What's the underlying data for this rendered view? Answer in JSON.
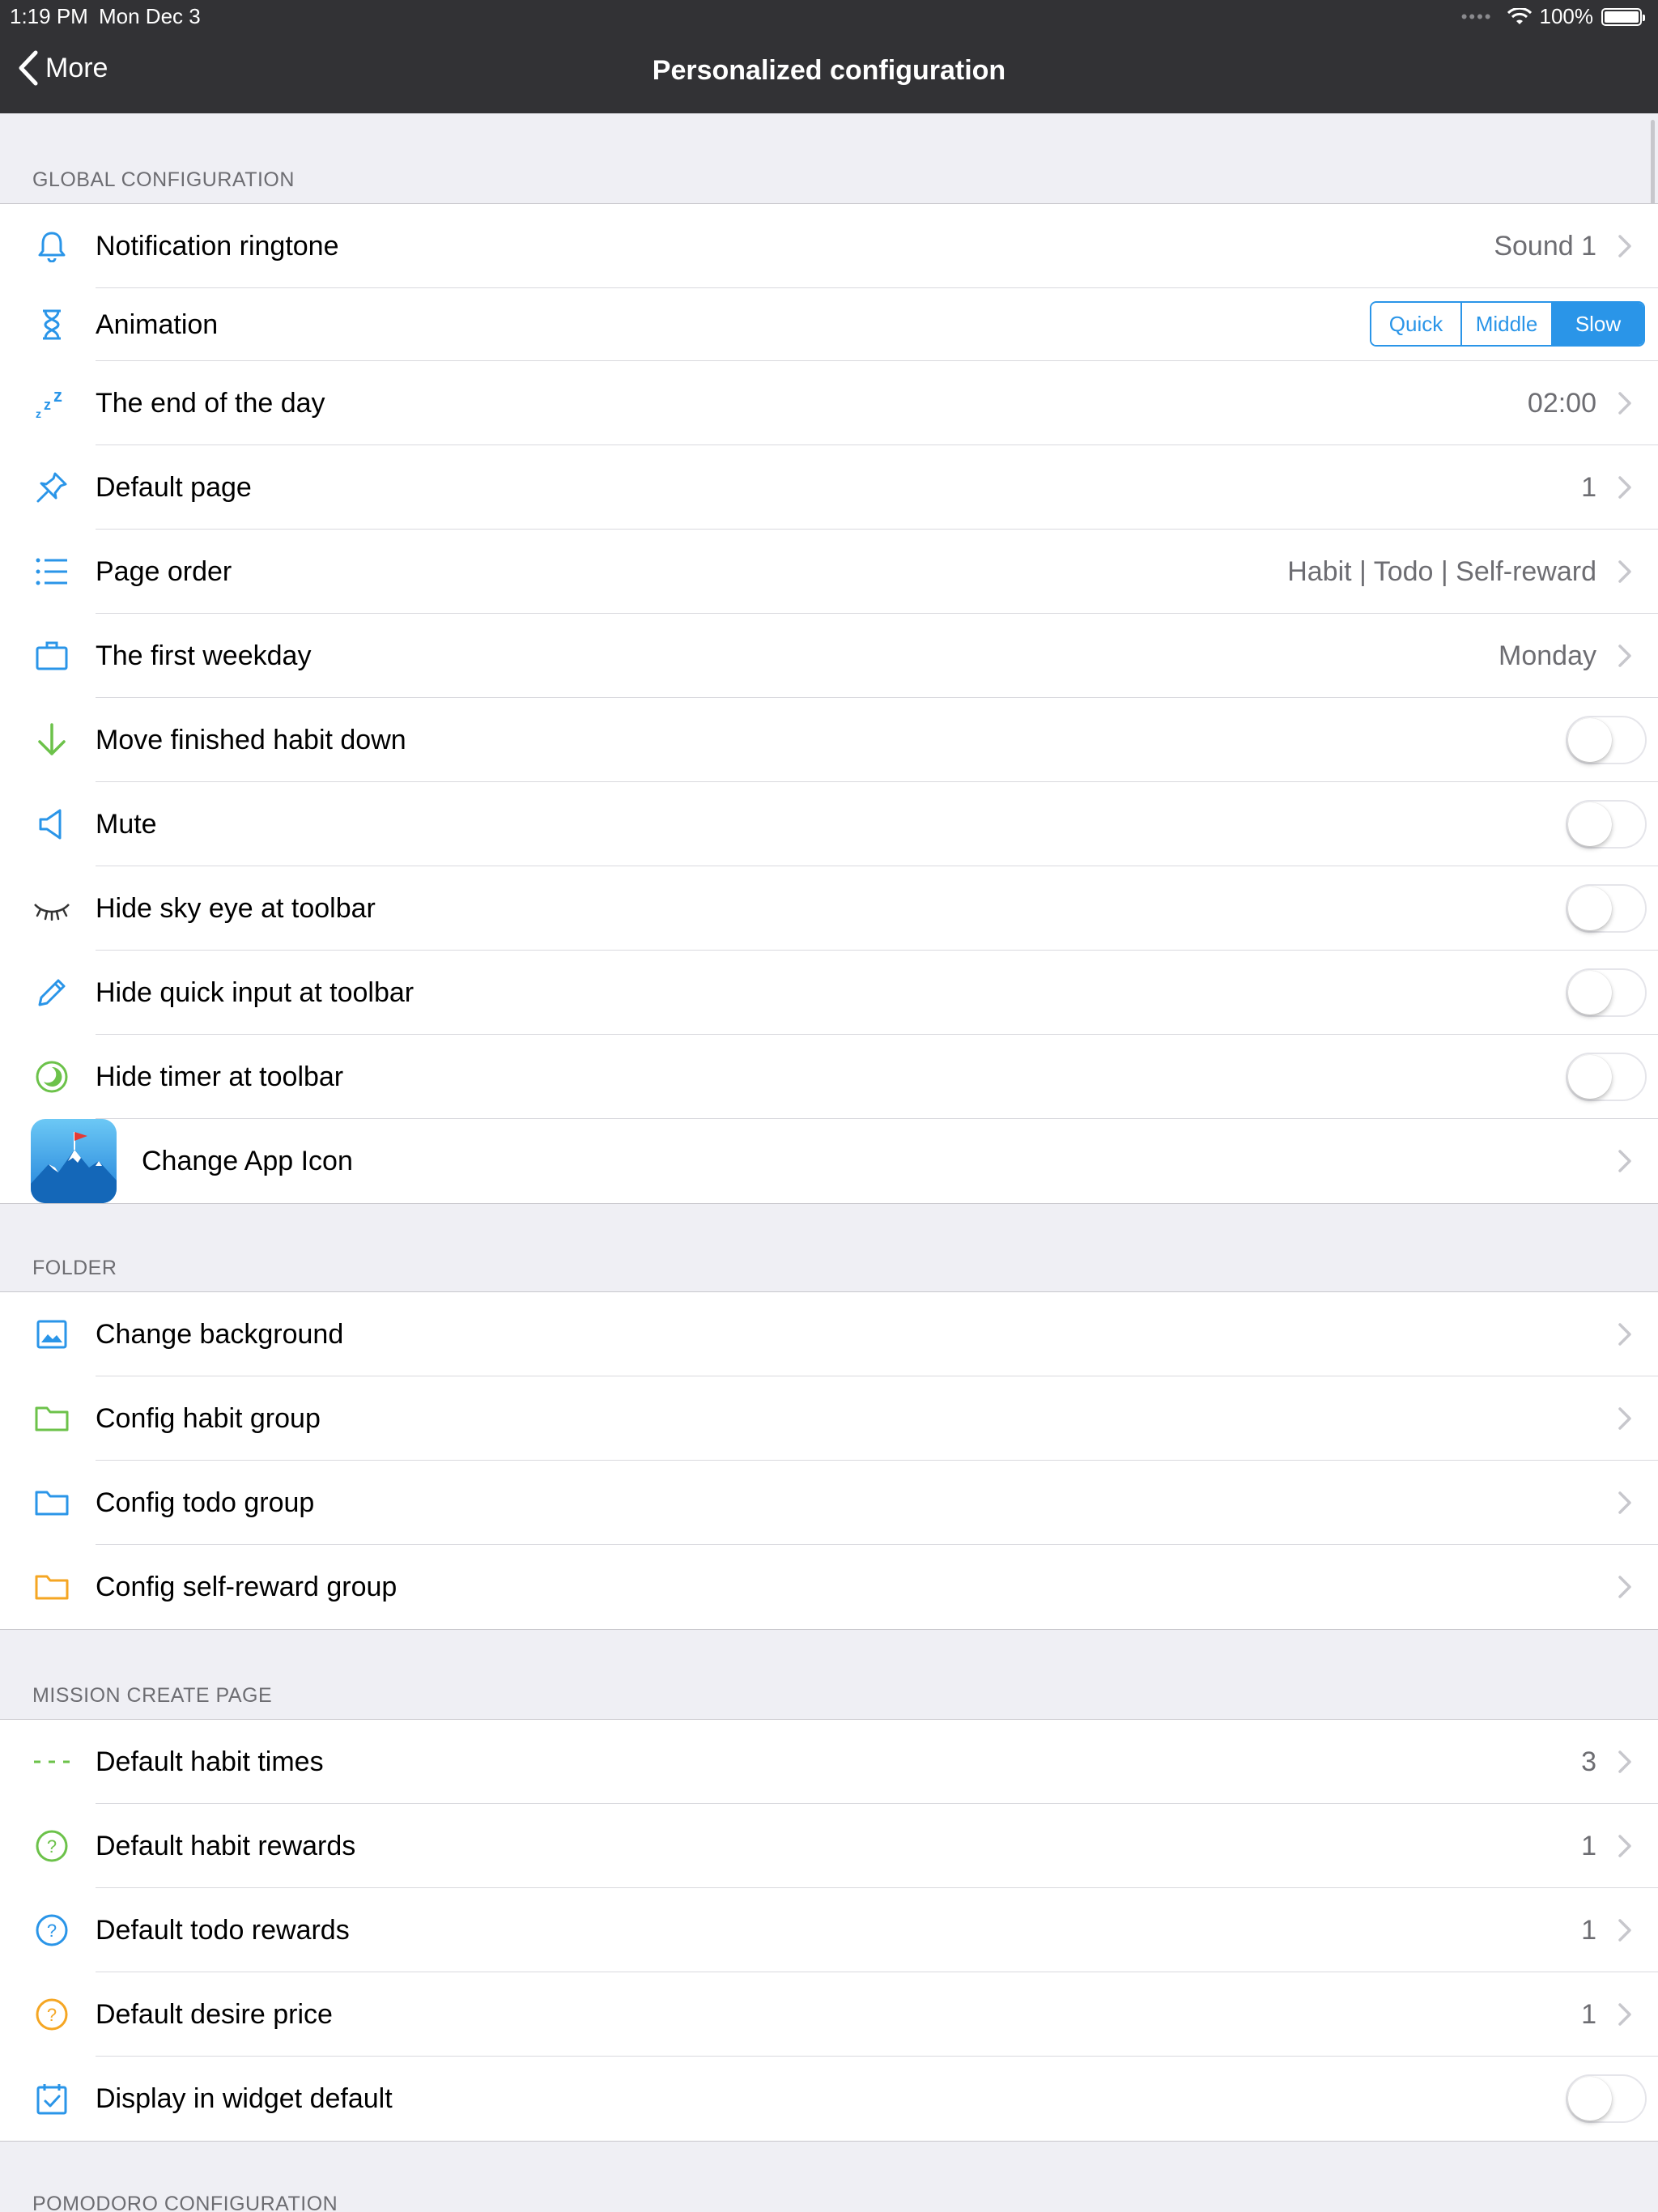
{
  "status": {
    "time": "1:19 PM",
    "date": "Mon Dec 3",
    "dots": "••••",
    "battery": "100%"
  },
  "nav": {
    "back_label": "More",
    "title": "Personalized configuration"
  },
  "sections": {
    "global": {
      "title": "GLOBAL CONFIGURATION",
      "notification": {
        "label": "Notification ringtone",
        "value": "Sound 1"
      },
      "animation": {
        "label": "Animation",
        "options": [
          "Quick",
          "Middle",
          "Slow"
        ],
        "selected": "Slow"
      },
      "end_of_day": {
        "label": "The end of the day",
        "value": "02:00"
      },
      "default_page": {
        "label": "Default page",
        "value": "1"
      },
      "page_order": {
        "label": "Page order",
        "value": "Habit | Todo | Self-reward"
      },
      "first_weekday": {
        "label": "The first weekday",
        "value": "Monday"
      },
      "move_finished": {
        "label": "Move finished habit down",
        "on": false
      },
      "mute": {
        "label": "Mute",
        "on": false
      },
      "hide_sky_eye": {
        "label": "Hide sky eye at toolbar",
        "on": false
      },
      "hide_quick_input": {
        "label": "Hide quick input at toolbar",
        "on": false
      },
      "hide_timer": {
        "label": "Hide timer at toolbar",
        "on": false
      },
      "change_app_icon": {
        "label": "Change App Icon"
      }
    },
    "folder": {
      "title": "FOLDER",
      "change_background": {
        "label": "Change background"
      },
      "habit_group": {
        "label": "Config habit group"
      },
      "todo_group": {
        "label": "Config todo group"
      },
      "self_reward_group": {
        "label": "Config self-reward group"
      }
    },
    "mission": {
      "title": "MISSION CREATE PAGE",
      "habit_times": {
        "label": "Default habit times",
        "value": "3"
      },
      "habit_rewards": {
        "label": "Default habit rewards",
        "value": "1"
      },
      "todo_rewards": {
        "label": "Default todo rewards",
        "value": "1"
      },
      "desire_price": {
        "label": "Default desire price",
        "value": "1"
      },
      "widget_default": {
        "label": "Display in widget default",
        "on": false
      }
    },
    "pomodoro": {
      "title": "POMODORO CONFIGURATION"
    }
  },
  "colors": {
    "accent_blue": "#2a95e8",
    "accent_green": "#6cc24a",
    "accent_orange": "#f5a623",
    "nav_bg": "#323235"
  },
  "icons": [
    "bell-icon",
    "hourglass-icon",
    "sleep-icon",
    "pin-icon",
    "list-icon",
    "briefcase-icon",
    "arrow-down-icon",
    "speaker-icon",
    "closed-eye-icon",
    "pencil-icon",
    "timer-icon",
    "app-icon",
    "image-icon",
    "folder-icon",
    "dashes-icon",
    "question-circle-icon",
    "calendar-check-icon",
    "chevron-right-icon"
  ]
}
